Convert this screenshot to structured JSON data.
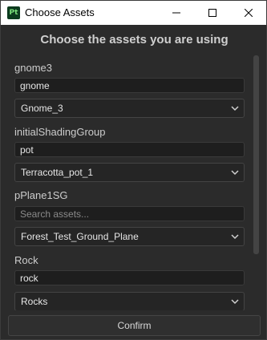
{
  "window": {
    "app_icon_text": "Pt",
    "title": "Choose Assets"
  },
  "heading": "Choose the assets you are using",
  "groups": [
    {
      "label": "gnome3",
      "search_value": "gnome",
      "search_placeholder": "Search assets...",
      "selected": "Gnome_3"
    },
    {
      "label": "initialShadingGroup",
      "search_value": "pot",
      "search_placeholder": "Search assets...",
      "selected": "Terracotta_pot_1"
    },
    {
      "label": "pPlane1SG",
      "search_value": "",
      "search_placeholder": "Search assets...",
      "selected": "Forest_Test_Ground_Plane"
    },
    {
      "label": "Rock",
      "search_value": "rock",
      "search_placeholder": "Search assets...",
      "selected": "Rocks"
    }
  ],
  "confirm_label": "Confirm",
  "colors": {
    "background": "#2b2b2b",
    "titlebar": "#ffffff",
    "field": "#1e1e1e",
    "text": "#cccccc"
  }
}
